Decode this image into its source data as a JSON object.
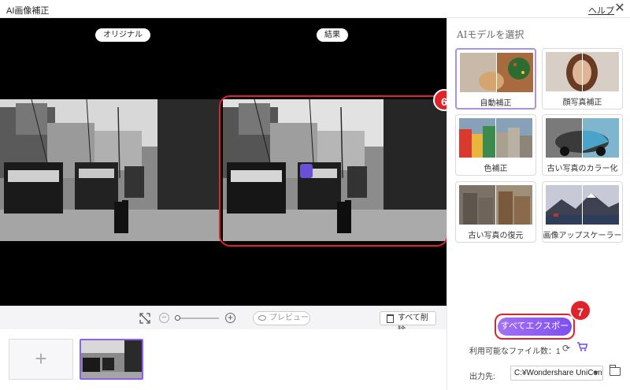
{
  "window": {
    "title": "AI画像補正",
    "help": "ヘルプ",
    "close": "✕"
  },
  "canvas": {
    "original_label": "オリジナル",
    "result_label": "結果",
    "callout_6": "6"
  },
  "toolbar": {
    "preview": "プレビュー",
    "delete_all": "すべて削除"
  },
  "thumbnails": {
    "add": "+"
  },
  "panel": {
    "heading": "AIモデルを選択",
    "models": [
      {
        "label": "自動補正"
      },
      {
        "label": "顔写真補正"
      },
      {
        "label": "色補正"
      },
      {
        "label": "古い写真のカラー化"
      },
      {
        "label": "古い写真の復元"
      },
      {
        "label": "画像アップスケーラー"
      }
    ],
    "export": "すべてエクスポート",
    "callout_7": "7",
    "files_left": "利用可能なファイル数：1",
    "output_label": "出力先:",
    "output_path": "C:¥Wondershare UniConv"
  },
  "colors": {
    "accent": "#8f60e8",
    "callout": "#e0232a"
  }
}
